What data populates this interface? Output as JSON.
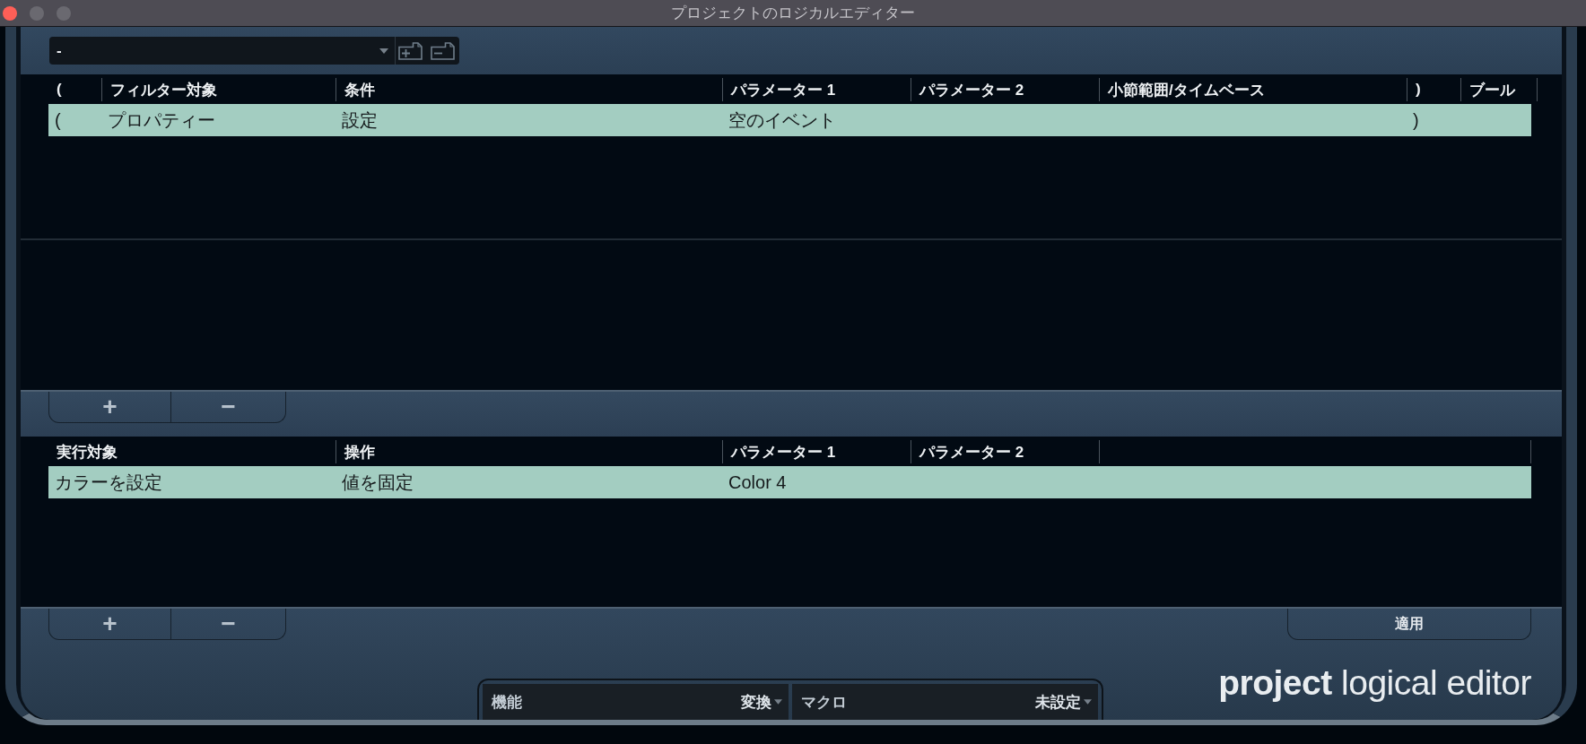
{
  "window": {
    "title": "プロジェクトのロジカルエディター",
    "buttons": [
      {
        "kind": "close",
        "disabled": false
      },
      {
        "kind": "minimize",
        "disabled": true
      },
      {
        "kind": "zoom",
        "disabled": true
      }
    ]
  },
  "preset": {
    "value": "-"
  },
  "filter_table": {
    "columns": {
      "open_bracket": "(",
      "filter_target": "フィルター対象",
      "condition": "条件",
      "parameter_1": "パラメーター 1",
      "parameter_2": "パラメーター 2",
      "bar_range_time_base": "小節範囲/タイムベース",
      "close_bracket": ")",
      "boolean": "ブール"
    },
    "rows": [
      {
        "selected": true,
        "cells": {
          "open_bracket": "(",
          "filter_target": "プロパティー",
          "condition": "設定",
          "parameter_1": "空のイベント",
          "close_bracket": ")"
        }
      }
    ]
  },
  "filter_buttons": [
    {
      "kind": "add",
      "label": "+"
    },
    {
      "kind": "remove",
      "label": "−"
    }
  ],
  "action_table": {
    "columns": {
      "action_target": "実行対象",
      "operation": "操作",
      "parameter_1": "パラメーター 1",
      "parameter_2": "パラメーター 2"
    },
    "rows": [
      {
        "selected": true,
        "cells": {
          "action_target": "カラーを設定",
          "operation": "値を固定",
          "parameter_1": "Color 4"
        }
      }
    ]
  },
  "action_buttons": [
    {
      "kind": "add",
      "label": "+"
    },
    {
      "kind": "remove",
      "label": "−"
    }
  ],
  "apply_button": "適用",
  "selectors": [
    {
      "label": "機能",
      "value": "変換"
    },
    {
      "label": "マクロ",
      "value": "未設定"
    }
  ],
  "logo": "**project** logical editor"
}
